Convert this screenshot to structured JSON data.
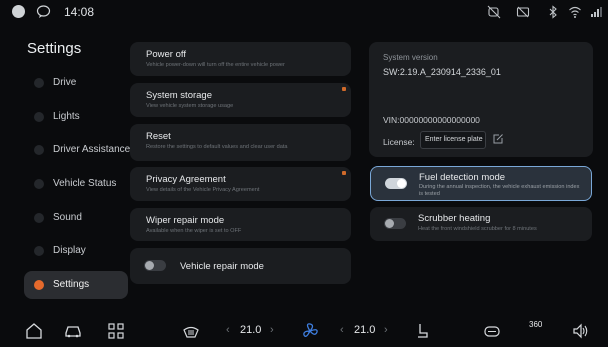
{
  "status_bar": {
    "time": "14:08",
    "icons": [
      "avatar-icon",
      "chat-icon",
      "camera-off-icon",
      "screen-off-icon",
      "bluetooth-icon",
      "wifi-icon",
      "signal-icon"
    ]
  },
  "sidebar": {
    "title": "Settings",
    "items": [
      {
        "label": "Drive",
        "icon": "drive-icon"
      },
      {
        "label": "Lights",
        "icon": "lights-icon"
      },
      {
        "label": "Driver Assistance",
        "icon": "driver-assistance-icon"
      },
      {
        "label": "Vehicle Status",
        "icon": "vehicle-status-icon"
      },
      {
        "label": "Sound",
        "icon": "sound-icon"
      },
      {
        "label": "Display",
        "icon": "display-icon"
      },
      {
        "label": "Settings",
        "icon": "settings-icon",
        "active": true
      }
    ]
  },
  "left_cards": {
    "power_off": {
      "title": "Power off",
      "desc": "Vehicle power-down will turn off the entire vehicle power"
    },
    "storage": {
      "title": "System storage",
      "desc": "View vehicle system storage usage"
    },
    "reset": {
      "title": "Reset",
      "desc": "Restore the settings to default values and clear user data"
    },
    "privacy": {
      "title": "Privacy Agreement",
      "desc": "View details of the Vehicle Privacy Agreement"
    },
    "wiper": {
      "title": "Wiper repair mode",
      "desc": "Available when the wiper is set to OFF"
    },
    "repair": {
      "title": "Vehicle repair mode",
      "enabled": false
    }
  },
  "info": {
    "version_label": "System version",
    "version_value": "SW:2.19.A_230914_2336_01",
    "vin": "VIN:00000000000000000",
    "license_label": "License:",
    "license_placeholder": "Enter license plate"
  },
  "right_cards": {
    "fuel": {
      "title": "Fuel detection mode",
      "desc": "During the annual inspection, the vehicle exhaust emission index is tested",
      "enabled": true
    },
    "scrubber": {
      "title": "Scrubber heating",
      "desc": "Heat the front windshield scrubber for 8 minutes",
      "enabled": false
    }
  },
  "dock": {
    "left_temp": "21.0",
    "right_temp": "21.0",
    "arrow_left": "‹",
    "arrow_right": "›",
    "view_360": "360",
    "icons": [
      "home-icon",
      "car-icon",
      "apps-icon",
      "defrost-icon",
      "fan-icon",
      "seat-icon",
      "rear-defrost-icon",
      "volume-icon"
    ]
  },
  "colors": {
    "accent": "#e66a2c",
    "card": "#1b1d20",
    "fuel_card_border": "#7aa8d8",
    "fan_icon": "#3f7fe0"
  }
}
